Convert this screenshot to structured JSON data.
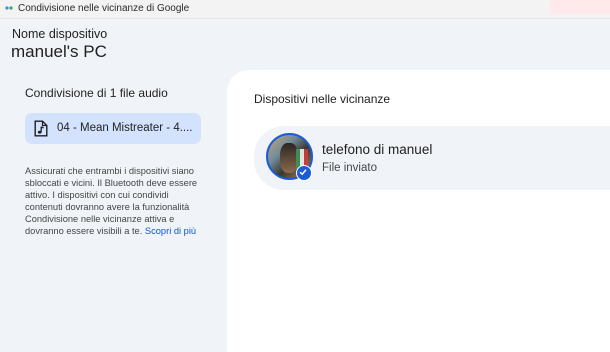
{
  "window": {
    "title": "Condivisione nelle vicinanze di Google",
    "icon": "nearby-share-app-icon"
  },
  "header": {
    "device_label": "Nome dispositivo",
    "device_name": "manuel's PC"
  },
  "left_panel": {
    "share_title": "Condivisione di 1 file audio",
    "file": {
      "icon": "music-note-file-icon",
      "name": "04 - Mean Mistreater - 4...."
    },
    "info_text": "Assicurati che entrambi i dispositivi siano sbloccati e vicini. Il Bluetooth deve essere attivo. I dispositivi con cui condividi contenuti dovranno avere la funzionalità Condivisione nelle vicinanze attiva e dovranno essere visibili a te.",
    "learn_more": "Scopri di più"
  },
  "right_panel": {
    "nearby_title": "Dispositivi nelle vicinanze",
    "devices": [
      {
        "name": "telefono di manuel",
        "status": "File inviato",
        "avatar_icon": "profile-avatar",
        "badge_icon": "check-badge-icon"
      }
    ]
  },
  "colors": {
    "accent": "#1a5bd6",
    "chip_bg": "#d3e3fd",
    "link": "#0b57d0",
    "page_bg": "#f0f3f8"
  }
}
